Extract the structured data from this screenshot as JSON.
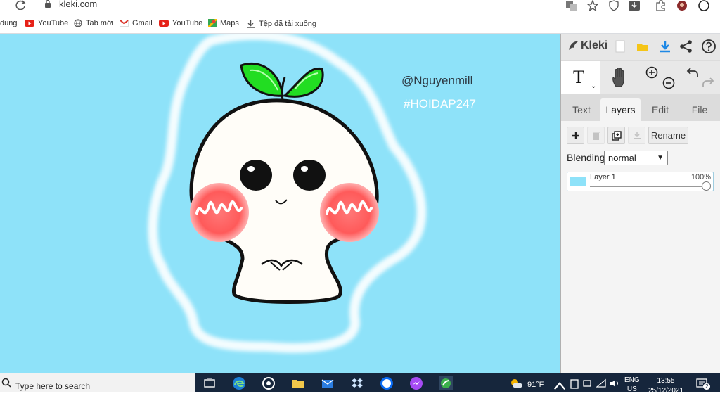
{
  "browser": {
    "url": "kleki.com"
  },
  "bookmarks": [
    {
      "label": "dung",
      "icon": "none"
    },
    {
      "label": "YouTube",
      "icon": "youtube-icon"
    },
    {
      "label": "Tab mới",
      "icon": "globe-icon"
    },
    {
      "label": "Gmail",
      "icon": "gmail-icon"
    },
    {
      "label": "YouTube",
      "icon": "youtube-icon"
    },
    {
      "label": "Maps",
      "icon": "maps-icon"
    },
    {
      "label": "Tệp đã tải xuống",
      "icon": "download-icon"
    }
  ],
  "canvas": {
    "background": "#8ee2f9",
    "watermark_handle": "@Nguyenmill",
    "watermark_tag": "#HOIDAP247"
  },
  "panel": {
    "app_name": "Kleki",
    "tabs": [
      {
        "label": "Text",
        "active": false
      },
      {
        "label": "Layers",
        "active": true
      },
      {
        "label": "Edit",
        "active": false
      },
      {
        "label": "File",
        "active": false
      }
    ],
    "active_tool": "T",
    "rename_label": "Rename",
    "blending_label": "Blending",
    "blending_value": "normal",
    "layers": [
      {
        "name": "Layer 1",
        "opacity": "100%",
        "opacity_fraction": 1.0
      }
    ]
  },
  "taskbar": {
    "search_placeholder": "Type here to search",
    "weather": "91°F",
    "language": "ENG",
    "language_region": "US",
    "time": "13:55",
    "date": "25/12/2021",
    "notification_count": "2"
  },
  "colors": {
    "canvas_bg": "#8ee2f9",
    "sprout": "#22dd22",
    "blush": "#ff5a5a",
    "taskbar": "#16263c",
    "accent_blue": "#1e88e5"
  }
}
